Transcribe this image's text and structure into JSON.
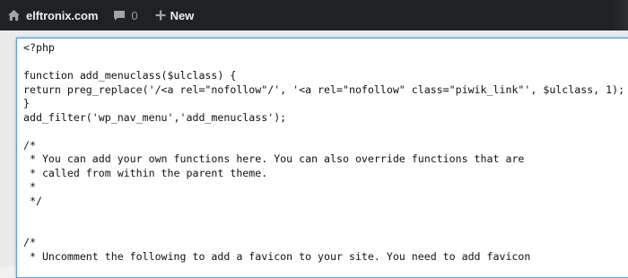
{
  "admin_bar": {
    "site_name": "elftronix.com",
    "comment_count": "0",
    "new_label": "New",
    "icons": {
      "site": "home-icon",
      "comments": "comment-bubble-icon",
      "new": "plus-icon"
    },
    "colors": {
      "background": "#1f2224",
      "text": "#eeeeee",
      "muted": "#9a9a9a"
    }
  },
  "editor": {
    "border_color": "#5b9dd9",
    "lines": [
      "<?php",
      "",
      "function add_menuclass($ulclass) {",
      "return preg_replace('/<a rel=\"nofollow\"/', '<a rel=\"nofollow\" class=\"piwik_link\"', $ulclass, 1);",
      "}",
      "add_filter('wp_nav_menu','add_menuclass');",
      "",
      "/*",
      " * You can add your own functions here. You can also override functions that are",
      " * called from within the parent theme.",
      " *",
      " */",
      "",
      "",
      "/*",
      " * Uncomment the following to add a favicon to your site. You need to add favicon"
    ]
  }
}
